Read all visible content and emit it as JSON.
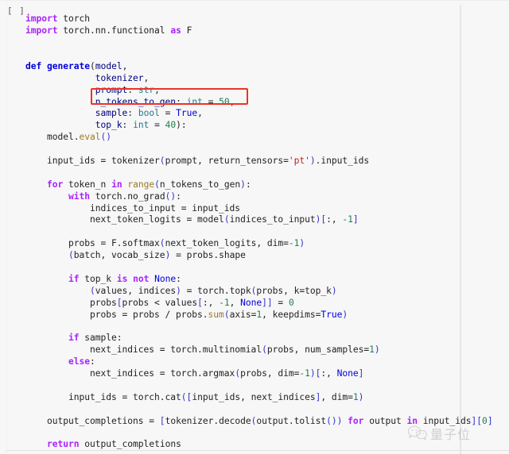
{
  "notebook": {
    "cell_marker": "[ ]",
    "language": "python",
    "highlight": {
      "color": "#ee3322",
      "target_line": "n_tokens_to_gen: int = 50,"
    },
    "code_lines": [
      "import torch",
      "import torch.nn.functional as F",
      "",
      "",
      "def generate(model,",
      "             tokenizer,",
      "             prompt: str,",
      "             n_tokens_to_gen: int = 50,",
      "             sample: bool = True,",
      "             top_k: int = 40):",
      "    model.eval()",
      "",
      "    input_ids = tokenizer(prompt, return_tensors='pt').input_ids",
      "",
      "    for token_n in range(n_tokens_to_gen):",
      "        with torch.no_grad():",
      "            indices_to_input = input_ids",
      "            next_token_logits = model(indices_to_input)[:, -1]",
      "",
      "        probs = F.softmax(next_token_logits, dim=-1)",
      "        (batch, vocab_size) = probs.shape",
      "",
      "        if top_k is not None:",
      "            (values, indices) = torch.topk(probs, k=top_k)",
      "            probs[probs < values[:, -1, None]] = 0",
      "            probs = probs / probs.sum(axis=1, keepdims=True)",
      "",
      "        if sample:",
      "            next_indices = torch.multinomial(probs, num_samples=1)",
      "        else:",
      "            next_indices = torch.argmax(probs, dim=-1)[:, None]",
      "",
      "        input_ids = torch.cat([input_ids, next_indices], dim=1)",
      "",
      "    output_completions = [tokenizer.decode(output.tolist()) for output in input_ids][0]",
      "",
      "    return output_completions"
    ]
  },
  "watermark": {
    "text": "量子位",
    "icon": "wechat-icon"
  },
  "colors": {
    "background": "#f7f7f7",
    "keyword": "#aa22ff",
    "definition": "#0000dd",
    "builtin_const": "#0000dd",
    "method": "#9b7a22",
    "number": "#208050",
    "string": "#bb2222",
    "type_annotation": "#1f7a8c",
    "parameter": "#000080",
    "highlight_rect": "#ee3322"
  }
}
